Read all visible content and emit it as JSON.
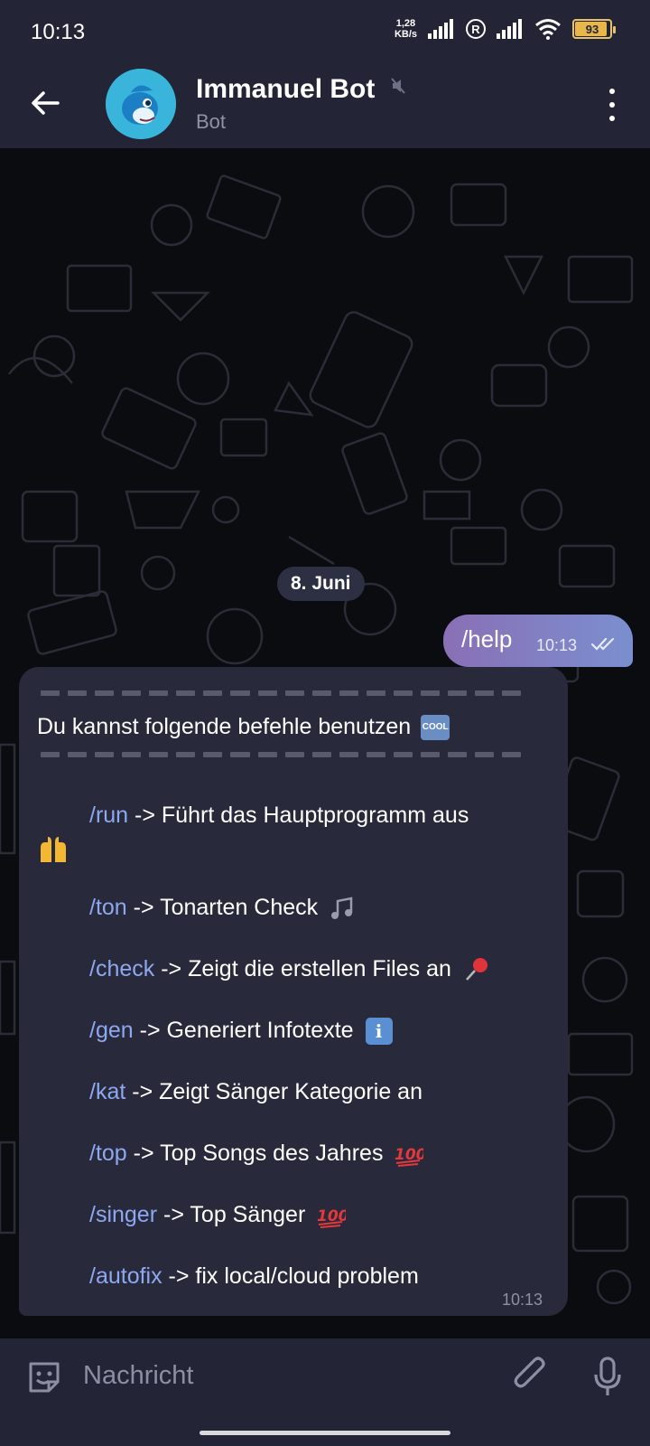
{
  "status_bar": {
    "time": "10:13",
    "net_speed_value": "1,28",
    "net_speed_unit": "KB/s",
    "battery_level": "93"
  },
  "header": {
    "title": "Immanuel Bot",
    "subtitle": "Bot"
  },
  "chat": {
    "date": "8. Juni",
    "outgoing": {
      "text": "/help",
      "time": "10:13",
      "status": "read"
    },
    "incoming": {
      "intro": "Du kannst folgende befehle benutzen",
      "intro_emoji": "COOL",
      "commands": [
        {
          "cmd": "/run",
          "desc": " -> Führt das Hauptprogramm aus"
        },
        {
          "cmd": "/ton",
          "desc": " -> Tonarten Check"
        },
        {
          "cmd": "/check",
          "desc": " -> Zeigt die erstellen Files an"
        },
        {
          "cmd": "/gen",
          "desc": " -> Generiert Infotexte"
        },
        {
          "cmd": "/kat",
          "desc": " -> Zeigt Sänger Kategorie an"
        },
        {
          "cmd": "/top",
          "desc": " -> Top Songs des Jahres"
        },
        {
          "cmd": "/singer",
          "desc": " -> Top Sänger"
        },
        {
          "cmd": "/autofix",
          "desc": " -> fix local/cloud problem"
        }
      ],
      "info_emoji": "i",
      "time": "10:13"
    }
  },
  "input": {
    "placeholder": "Nachricht",
    "value": ""
  },
  "colors": {
    "header_bg": "#232536",
    "bubble_in": "#282a3c",
    "command_link": "#8ea8f0",
    "bubble_out_start": "#8a6fb5",
    "bubble_out_end": "#7a8fcf"
  }
}
